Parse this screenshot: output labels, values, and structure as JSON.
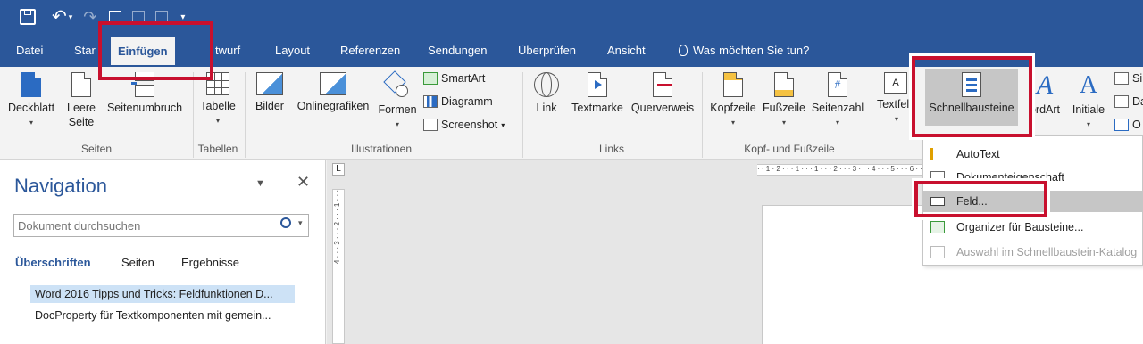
{
  "quick_access": {
    "icons": [
      "save-icon",
      "undo-icon",
      "redo-icon",
      "touch-mode-icon",
      "print-preview-icon",
      "customize-icon"
    ],
    "undo_caret": "▾"
  },
  "tabs": {
    "datei": "Datei",
    "start_partial": "Star",
    "einfuegen": "Einfügen",
    "entwurf_partial": "twurf",
    "layout": "Layout",
    "referenzen": "Referenzen",
    "sendungen": "Sendungen",
    "ueberpruefen": "Überprüfen",
    "ansicht": "Ansicht",
    "tell_me": "Was möchten Sie tun?"
  },
  "ribbon": {
    "seiten": {
      "label": "Seiten",
      "deckblatt": "Deckblatt",
      "leere_seite_1": "Leere",
      "leere_seite_2": "Seite",
      "seitenumbruch": "Seitenumbruch"
    },
    "tabellen": {
      "label": "Tabellen",
      "tabelle": "Tabelle"
    },
    "illustrationen": {
      "label": "Illustrationen",
      "bilder": "Bilder",
      "onlinegrafiken": "Onlinegrafiken",
      "formen": "Formen",
      "smartart": "SmartArt",
      "diagramm": "Diagramm",
      "screenshot": "Screenshot"
    },
    "links": {
      "label": "Links",
      "link": "Link",
      "textmarke": "Textmarke",
      "querverweis": "Querverweis"
    },
    "kopf_fuss": {
      "label": "Kopf- und Fußzeile",
      "kopfzeile": "Kopfzeile",
      "fusszeile": "Fußzeile",
      "seitenzahl": "Seitenzahl"
    },
    "text": {
      "textfeld_partial": "Textfel",
      "schnellbausteine": "Schnellbausteine",
      "wordart_partial": "ordArt",
      "initiale": "Initiale",
      "side_1": "Si",
      "side_2": "Da",
      "side_3": "O"
    },
    "caret": "▾"
  },
  "navigation": {
    "title": "Navigation",
    "search_placeholder": "Dokument durchsuchen",
    "tabs": [
      "Überschriften",
      "Seiten",
      "Ergebnisse"
    ],
    "items": [
      "Word 2016 Tipps und Tricks: Feldfunktionen D...",
      "DocProperty für Textkomponenten mit gemein..."
    ]
  },
  "document": {
    "tab_selector": "L",
    "ruler_text": "· · 1 · 2 · · · 1 · · · 1 · · · 2 · · · 3 · · · 4 · · · 5 · · · 6 · · · 7 · · ·",
    "vruler_text": "4 · · · 3 · · · 2 · · · 1 · · ·"
  },
  "quick_parts_menu": {
    "items": [
      {
        "label": "AutoText",
        "enabled": true
      },
      {
        "label": "Dokumenteigenschaft",
        "enabled": true
      },
      {
        "label": "Feld...",
        "enabled": true
      },
      {
        "label": "Organizer für Bausteine...",
        "enabled": true
      },
      {
        "label": "Auswahl im Schnellbaustein-Katalog",
        "enabled": false
      }
    ]
  },
  "colors": {
    "brand": "#2b579a",
    "highlight": "#c8102e",
    "hover": "#c6c6c6",
    "selected_nav": "#cde2f6"
  }
}
